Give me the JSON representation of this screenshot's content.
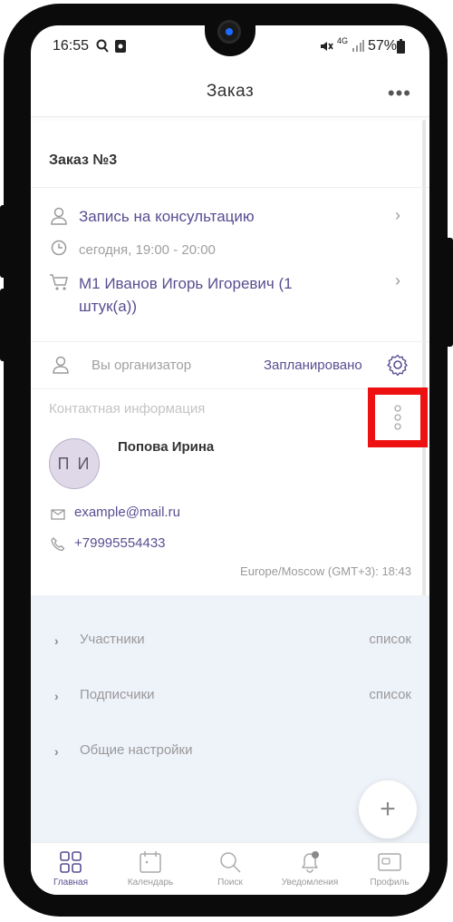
{
  "status_bar": {
    "time": "16:55",
    "network": "4G",
    "battery": "57%"
  },
  "header": {
    "title": "Заказ",
    "more_icon": "more-dots-icon"
  },
  "order": {
    "title": "Заказ №3",
    "service": "Запись на консультацию",
    "schedule": "сегодня, 19:00 - 20:00",
    "item_line1": "M1 Иванов Игорь Игоревич (1",
    "item_line2": "штук(а))",
    "role": "Вы организатор",
    "status": "Запланировано"
  },
  "contact": {
    "section_label": "Контактная информация",
    "avatar_initials": "П И",
    "name": "Попова Ирина",
    "email": "example@mail.ru",
    "phone": "+79995554433",
    "timezone": "Europe/Moscow (GMT+3): 18:43"
  },
  "sections": [
    {
      "label": "Участники",
      "right": "список"
    },
    {
      "label": "Подписчики",
      "right": "список"
    },
    {
      "label": "Общие настройки",
      "right": ""
    }
  ],
  "fab": {
    "label": "+"
  },
  "tabs": [
    {
      "label": "Главная",
      "icon": "home-grid-icon",
      "active": true
    },
    {
      "label": "Календарь",
      "icon": "calendar-icon",
      "active": false
    },
    {
      "label": "Поиск",
      "icon": "search-icon",
      "active": false
    },
    {
      "label": "Уведомления",
      "icon": "bell-icon",
      "active": false
    },
    {
      "label": "Профиль",
      "icon": "profile-card-icon",
      "active": false
    }
  ],
  "colors": {
    "accent": "#5a4d91",
    "highlight": "#ee1111",
    "settings_bg": "#eef2f9"
  }
}
